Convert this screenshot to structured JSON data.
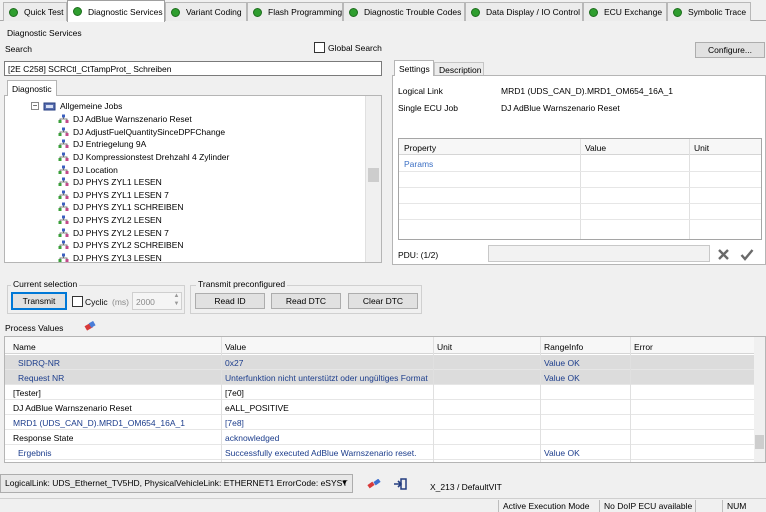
{
  "tabs": [
    {
      "label": "Quick Test",
      "active": false
    },
    {
      "label": "Diagnostic Services",
      "active": true
    },
    {
      "label": "Variant Coding",
      "active": false
    },
    {
      "label": "Flash Programming",
      "active": false
    },
    {
      "label": "Diagnostic Trouble Codes",
      "active": false
    },
    {
      "label": "Data Display / IO Control",
      "active": false
    },
    {
      "label": "ECU Exchange",
      "active": false
    },
    {
      "label": "Symbolic Trace",
      "active": false
    }
  ],
  "panel_title": "Diagnostic Services",
  "search": {
    "label": "Search",
    "global_label": "Global Search",
    "value": "[2E C258] SCRCtl_CtTampProt_ Schreiben"
  },
  "diagnostic_tab": "Diagnostic",
  "tree": {
    "group": "Allgemeine Jobs",
    "items": [
      "DJ AdBlue Warnszenario Reset",
      "DJ AdjustFuelQuantitySinceDPFChange",
      "DJ Entriegelung 9A",
      "DJ Kompressionstest Drehzahl 4 Zylinder",
      "DJ Location",
      "DJ PHYS ZYL1 LESEN",
      "DJ PHYS ZYL1 LESEN 7",
      "DJ PHYS ZYL1 SCHREIBEN",
      "DJ PHYS ZYL2 LESEN",
      "DJ PHYS ZYL2 LESEN 7",
      "DJ PHYS ZYL2 SCHREIBEN",
      "DJ PHYS ZYL3 LESEN"
    ]
  },
  "configure_button": "Configure...",
  "settings": {
    "tabs": [
      "Settings",
      "Description"
    ],
    "logical_link_label": "Logical Link",
    "logical_link_value": "MRD1 (UDS_CAN_D).MRD1_OM654_16A_1",
    "single_ecu_label": "Single ECU Job",
    "single_ecu_value": "DJ AdBlue Warnszenario Reset",
    "prop_headers": [
      "Property",
      "Value",
      "Unit"
    ],
    "params": "Params",
    "pdu_label": "PDU: (1/2)"
  },
  "current_selection": {
    "title": "Current selection",
    "transmit": "Transmit",
    "cyclic": "Cyclic",
    "ms": "(ms)",
    "interval": "2000"
  },
  "transmit_preconfigured": {
    "title": "Transmit preconfigured",
    "read_id": "Read ID",
    "read_dtc": "Read DTC",
    "clear_dtc": "Clear DTC"
  },
  "process_values": {
    "title": "Process Values",
    "headers": [
      "Name",
      "Value",
      "Unit",
      "RangeInfo",
      "Error"
    ],
    "rows": [
      {
        "name": "SIDRQ-NR",
        "value": "0x27",
        "unit": "",
        "range": "Value OK",
        "error": ""
      },
      {
        "name": "Request NR",
        "value": "Unterfunktion nicht unterstützt oder ungültiges Format",
        "unit": "",
        "range": "Value OK",
        "error": ""
      },
      {
        "name": "[Tester]",
        "value": "[7e0]",
        "unit": "",
        "range": "",
        "error": ""
      },
      {
        "name": "DJ AdBlue Warnszenario Reset",
        "value": "eALL_POSITIVE",
        "unit": "",
        "range": "",
        "error": ""
      },
      {
        "name": "MRD1 (UDS_CAN_D).MRD1_OM654_16A_1",
        "value": "[7e8]",
        "unit": "",
        "range": "",
        "error": ""
      },
      {
        "name": "Response State",
        "value": "acknowledged",
        "unit": "",
        "range": "",
        "error": ""
      },
      {
        "name": "Ergebnis",
        "value": "Successfully executed AdBlue Warnszenario reset.",
        "unit": "",
        "range": "Value OK",
        "error": ""
      }
    ]
  },
  "bottom": {
    "link_select": "LogicalLink: UDS_Ethernet_TV5HD, PhysicalVehicleLink: ETHERNET1 ErrorCode: eSYST",
    "vit": "X_213 / DefaultVIT"
  },
  "status": {
    "mode": "Active Execution Mode",
    "doip": "No DoIP ECU available",
    "num": "NUM"
  },
  "colors": {
    "tab_icon": "#2f9e2f",
    "link_text": "#1c3d8c",
    "selected_row": "#dcdcdc",
    "apply_check": "#6a6a6a"
  },
  "icons": [
    "tree-expand-icon",
    "job-folder-icon",
    "job-node-icon",
    "process-clear-icon",
    "link-disconnect-icon",
    "vit-login-icon",
    "discard-icon",
    "apply-icon"
  ]
}
